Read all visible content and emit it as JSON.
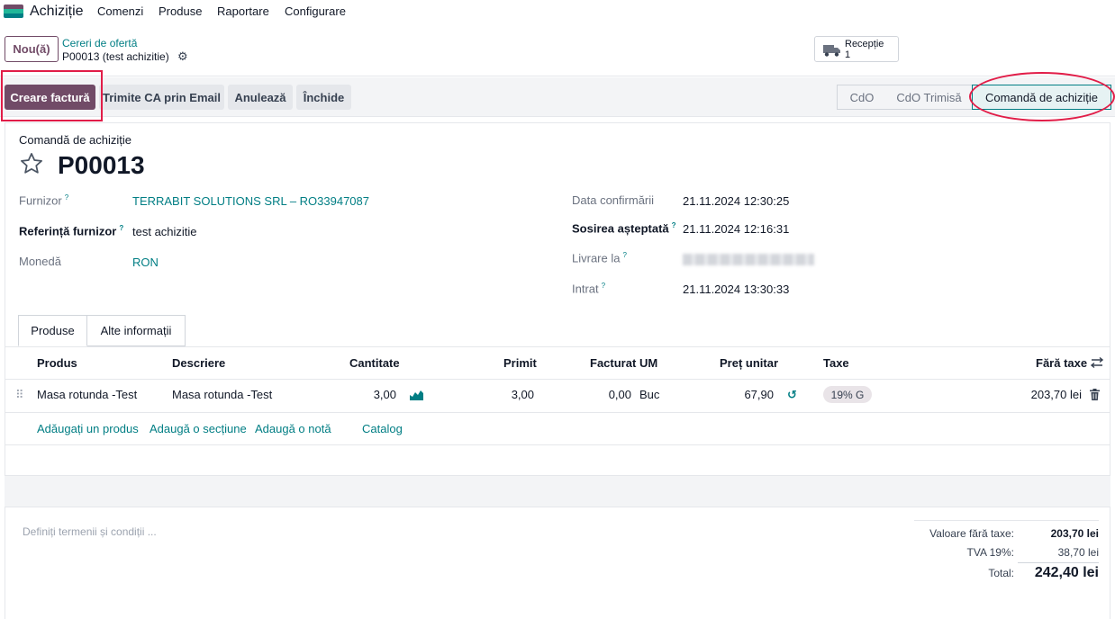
{
  "nav": {
    "app_title": "Achiziție",
    "menu": [
      "Comenzi",
      "Produse",
      "Raportare",
      "Configurare"
    ],
    "app_icon_colors": [
      "#714B67",
      "#21b799",
      "#017E84"
    ]
  },
  "control": {
    "new_label": "Nou(ă)",
    "breadcrumb_parent": "Cereri de ofertă",
    "breadcrumb_current": "P00013 (test achizitie)",
    "smart_button": {
      "label": "Recepție",
      "count": "1"
    }
  },
  "actions": {
    "create_invoice": "Creare factură",
    "send_email": "Trimite CA prin Email",
    "cancel": "Anulează",
    "lock": "Închide"
  },
  "status": [
    "CdO",
    "CdO Trimisă",
    "Comandă de achiziție"
  ],
  "status_active": "Comandă de achiziție",
  "form": {
    "type_label": "Comandă de achiziție",
    "name": "P00013",
    "vendor_label": "Furnizor",
    "vendor": "TERRABIT SOLUTIONS SRL – RO33947087",
    "vendor_ref_label": "Referință furnizor",
    "vendor_ref": "test achizitie",
    "currency_label": "Monedă",
    "currency": "RON",
    "confirm_date_label": "Data confirmării",
    "confirm_date": "21.11.2024 12:30:25",
    "expected_label": "Sosirea așteptată",
    "expected": "21.11.2024 12:16:31",
    "deliver_to_label": "Livrare la",
    "received_label": "Intrat",
    "received": "21.11.2024 13:30:33"
  },
  "tabs": [
    "Produse",
    "Alte informații"
  ],
  "table": {
    "columns": [
      "Produs",
      "Descriere",
      "Cantitate",
      "Primit",
      "Facturat",
      "UM",
      "Preț unitar",
      "Taxe",
      "Fără taxe"
    ],
    "rows": [
      {
        "product": "Masa rotunda -Test",
        "description": "Masa rotunda -Test",
        "qty": "3,00",
        "received": "3,00",
        "billed": "0,00",
        "uom": "Buc",
        "price": "67,90",
        "tax": "19% G",
        "subtotal": "203,70 lei"
      }
    ],
    "add_links": [
      "Adăugați un produs",
      "Adaugă o secțiune",
      "Adaugă o notă",
      "Catalog"
    ]
  },
  "terms_placeholder": "Definiți termenii și condiții ...",
  "totals": {
    "untaxed_label": "Valoare fără taxe:",
    "untaxed": "203,70 lei",
    "tax_label": "TVA 19%:",
    "tax": "38,70 lei",
    "total_label": "Total:",
    "total": "242,40 lei"
  },
  "colors": {
    "brand": "#714B67",
    "link": "#017E84",
    "highlight": "#e11d48"
  }
}
